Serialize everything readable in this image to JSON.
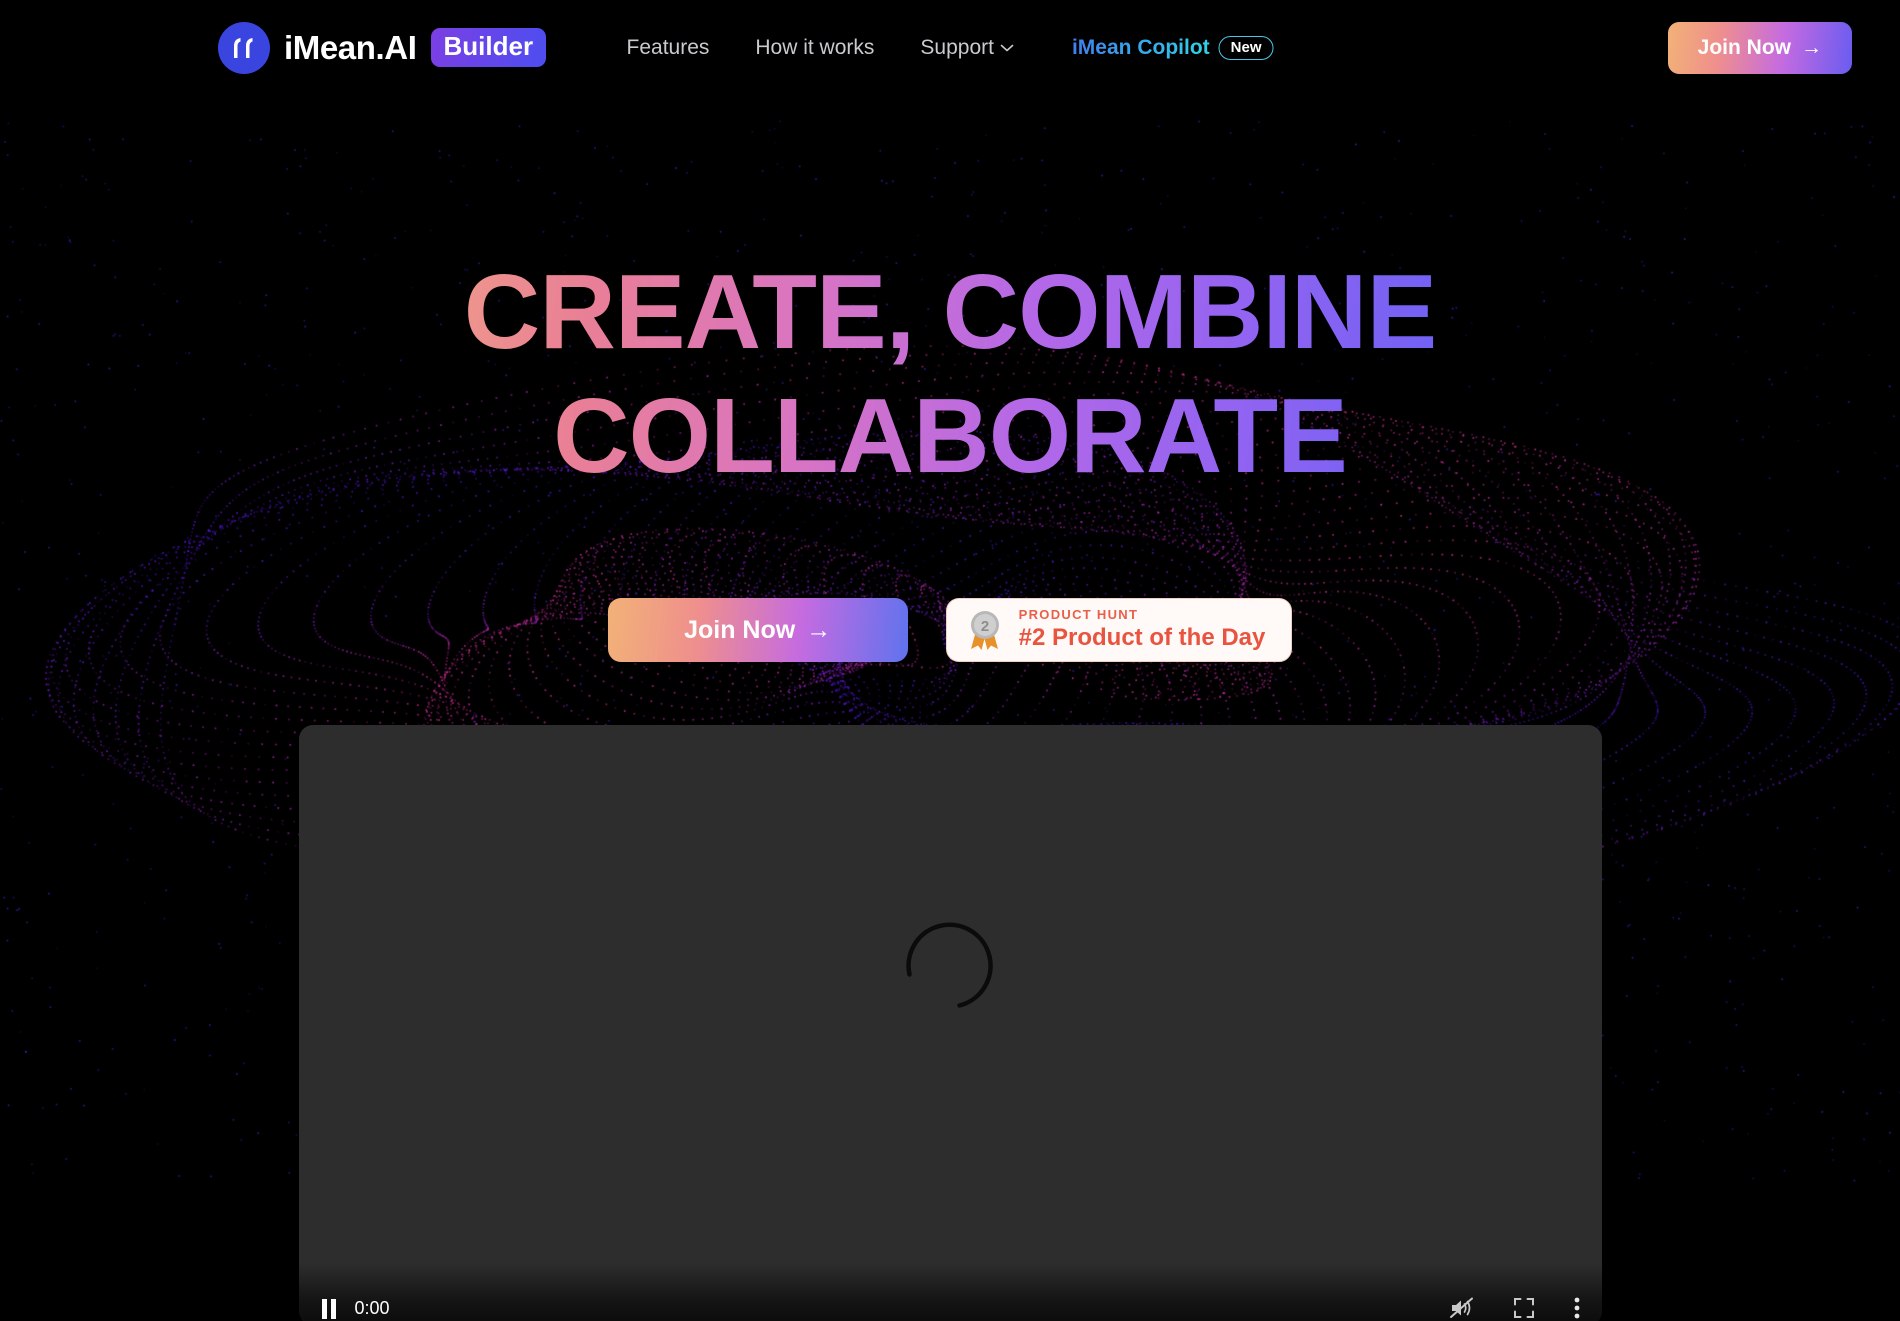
{
  "header": {
    "brand": {
      "mark_icon": "quote-mark-icon",
      "name": "iMean.AI",
      "badge": "Builder"
    },
    "nav": [
      {
        "label": "Features",
        "has_chevron": false
      },
      {
        "label": "How it works",
        "has_chevron": false
      },
      {
        "label": "Support",
        "has_chevron": true
      }
    ],
    "copilot": {
      "label": "iMean Copilot",
      "badge": "New"
    },
    "join_button": {
      "label": "Join Now",
      "arrow": "→"
    }
  },
  "hero": {
    "headline_line1": "CREATE, COMBINE",
    "headline_line2": "COLLABORATE",
    "cta": {
      "label": "Join Now",
      "arrow": "→"
    },
    "product_hunt": {
      "kicker": "PRODUCT HUNT",
      "title": "#2 Product of the Day",
      "medal_number": "2"
    }
  },
  "video": {
    "state": "loading",
    "spinner_icon": "loading-spinner-icon",
    "controls": {
      "play_pause_icon": "pause-icon",
      "current_time": "0:00",
      "volume_icon": "volume-muted-icon",
      "fullscreen_icon": "fullscreen-icon",
      "more_options_icon": "more-vertical-icon"
    }
  },
  "colors": {
    "background": "#000000",
    "brand_blue": "#3a45e0",
    "builder_gradient_start": "#7b3fe4",
    "builder_gradient_end": "#4d4ef0",
    "copilot_gradient_start": "#3f7ff0",
    "copilot_gradient_end": "#2fd3e8",
    "new_badge_border": "#49c7e8",
    "cta_gradient_start": "#f2b277",
    "cta_gradient_mid": "#c56be0",
    "cta_gradient_end": "#6a5cf0",
    "headline_gradient_start": "#f6cf94",
    "headline_gradient_end": "#5a63f5",
    "product_hunt_bg": "#fffaf7",
    "product_hunt_text": "#e8543f",
    "video_bg": "#2d2d2d",
    "nav_text": "#c9c9cf"
  }
}
